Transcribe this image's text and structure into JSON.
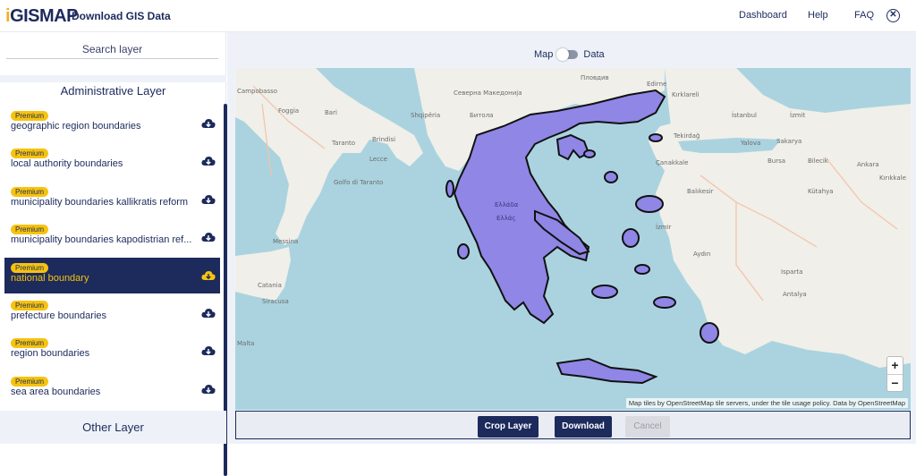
{
  "header": {
    "logo_i": "i",
    "logo_text": "GISMAP",
    "title": "Download GIS Data",
    "nav": [
      "Dashboard",
      "Help",
      "FAQ"
    ],
    "close_icon": "close-circle-icon"
  },
  "sidebar": {
    "search_placeholder": "Search layer",
    "section_title": "Administrative Layer",
    "items": [
      {
        "badge": "Premium",
        "label": "geographic region boundaries",
        "active": false
      },
      {
        "badge": "Premium",
        "label": "local authority boundaries",
        "active": false
      },
      {
        "badge": "Premium",
        "label": "municipality boundaries kallikratis reform",
        "active": false
      },
      {
        "badge": "Premium",
        "label": "municipality boundaries kapodistrian ref...",
        "active": false
      },
      {
        "badge": "Premium",
        "label": "national boundary",
        "active": true
      },
      {
        "badge": "Premium",
        "label": "prefecture boundaries",
        "active": false
      },
      {
        "badge": "Premium",
        "label": "region boundaries",
        "active": false
      },
      {
        "badge": "Premium",
        "label": "sea area boundaries",
        "active": false
      }
    ],
    "other_section_title": "Other Layer",
    "download_icon": "cloud-download-icon"
  },
  "main": {
    "toggle_left": "Map",
    "toggle_right": "Data",
    "zoom_in": "+",
    "zoom_out": "−",
    "attribution": "Map tiles by OpenStreetMap tile servers, under the tile usage policy. Data by OpenStreetMap",
    "buttons": {
      "crop": "Crop Layer",
      "download": "Download",
      "cancel": "Cancel"
    }
  },
  "map_labels": {
    "campobasso": "Campobasso",
    "foggia": "Foggia",
    "bari": "Bari",
    "taranto": "Taranto",
    "brindisi": "Brindisi",
    "lecce": "Lecce",
    "golfo": "Golfo di Taranto",
    "messina": "Messina",
    "catania": "Catania",
    "siracusa": "Siracusa",
    "malta": "Malta",
    "shqiperia": "Shqipëria",
    "makedonija": "Северна Македонија",
    "bitola": "Битола",
    "plovdiv": "Пловдив",
    "edirne": "Edirne",
    "kirklareli": "Kırklareli",
    "istanbul": "İstanbul",
    "izmit": "İzmit",
    "sakarya": "Sakarya",
    "tekirdag": "Tekirdağ",
    "yalova": "Yalova",
    "bursa": "Bursa",
    "bilecik": "Bilecik",
    "canakkale": "Çanakkale",
    "balikesir": "Balıkesir",
    "kutahya": "Kütahya",
    "ankara": "Ankara",
    "kirikkale": "Kırıkkale",
    "izmir": "İzmir",
    "aydin": "Aydın",
    "isparta": "Isparta",
    "antalya": "Antalya",
    "elladas": "Ελλάς",
    "greece_label": "Ελλάδα"
  },
  "colors": {
    "brand_navy": "#1c2a5c",
    "premium_yellow": "#f6c30f",
    "greece_fill": "#8f86e6",
    "sea": "#aad3df",
    "land": "#f0efe9"
  }
}
